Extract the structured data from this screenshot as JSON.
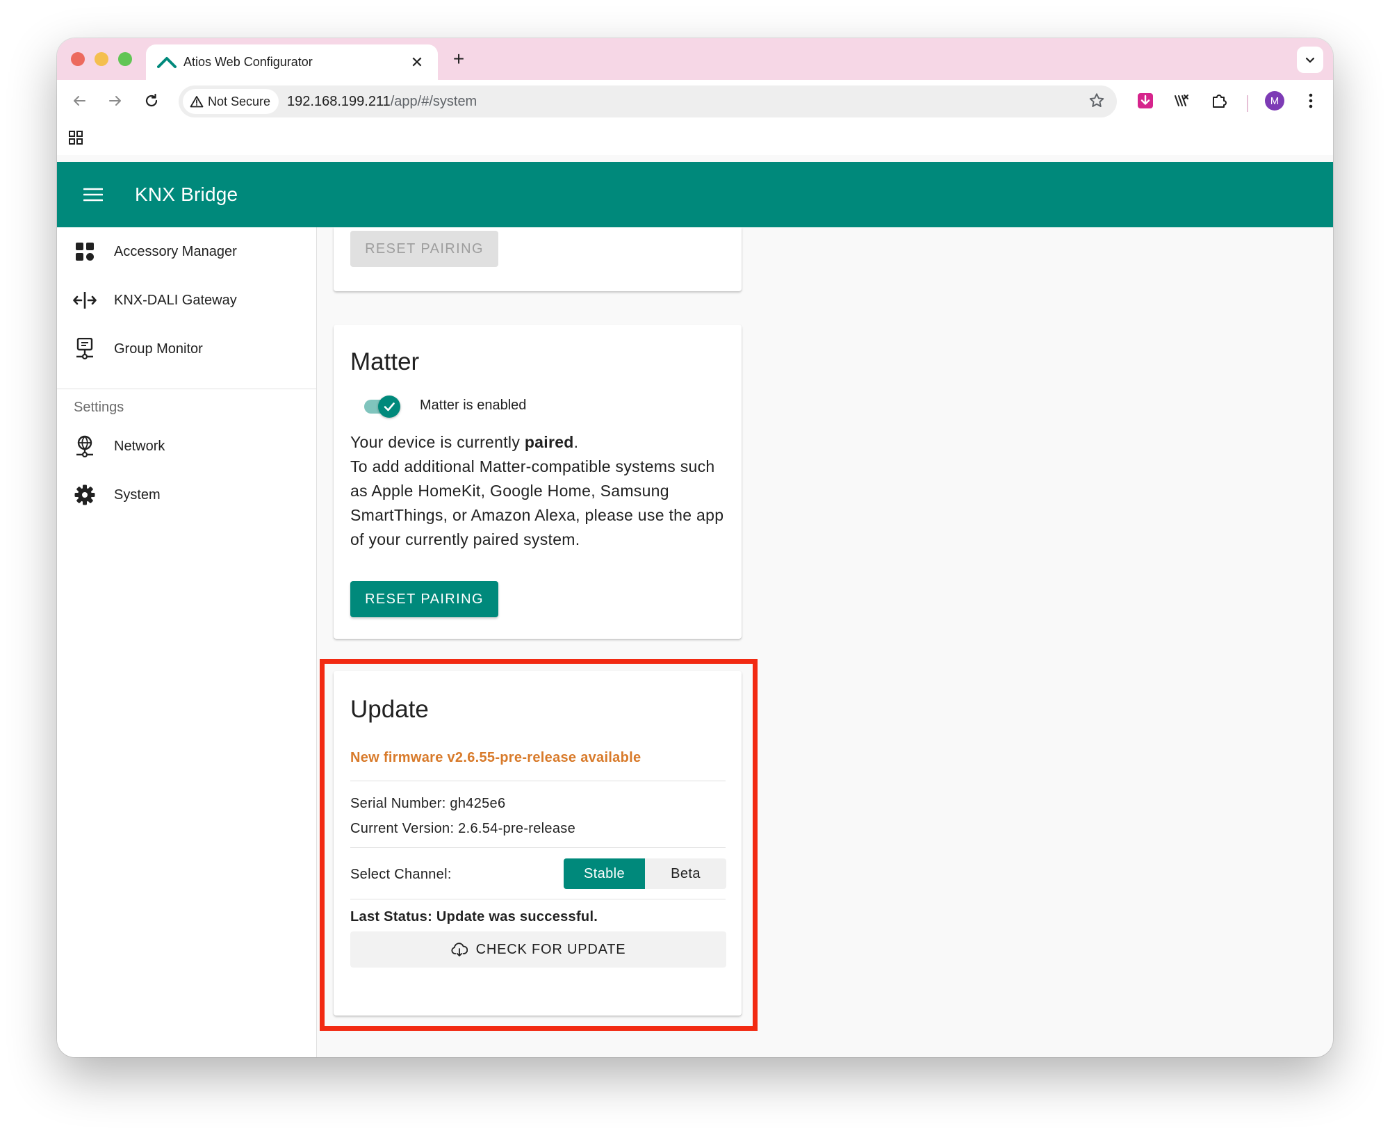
{
  "browser": {
    "tab_title": "Atios Web Configurator",
    "security_label": "Not Secure",
    "url_host": "192.168.199.211",
    "url_path": "/app/#/system",
    "profile_initial": "M"
  },
  "app": {
    "title": "KNX Bridge"
  },
  "sidebar": {
    "items": [
      {
        "label": "Accessory Manager",
        "icon": "dashboard-icon"
      },
      {
        "label": "KNX-DALI Gateway",
        "icon": "gateway-arrows-icon"
      },
      {
        "label": "Group Monitor",
        "icon": "monitor-icon"
      }
    ],
    "settings_header": "Settings",
    "settings_items": [
      {
        "label": "Network",
        "icon": "network-globe-icon"
      },
      {
        "label": "System",
        "icon": "gear-icon"
      }
    ]
  },
  "cards": {
    "top_card": {
      "button_label": "RESET PAIRING",
      "button_state": "disabled"
    },
    "matter": {
      "title": "Matter",
      "toggle_label": "Matter is enabled",
      "toggle_on": true,
      "status_prefix": "Your device is currently ",
      "status_value": "paired",
      "status_suffix": ".",
      "description": "To add additional Matter-compatible systems such as Apple HomeKit, Google Home, Samsung SmartThings, or Amazon Alexa, please use the app of your currently paired system.",
      "button_label": "RESET PAIRING"
    },
    "update": {
      "title": "Update",
      "firmware_notice": "New firmware v2.6.55-pre-release available",
      "serial_number": "Serial Number: gh425e6",
      "current_version": "Current Version: 2.6.54-pre-release",
      "select_channel_label": "Select Channel:",
      "channels": [
        "Stable",
        "Beta"
      ],
      "selected_channel": "Stable",
      "last_status": "Last Status: Update was successful.",
      "check_button_label": "CHECK FOR UPDATE"
    }
  },
  "colors": {
    "primary": "#00897b",
    "tabstrip": "#f6d7e6",
    "firmware_notice": "#d87a2a",
    "highlight": "#f22a12"
  }
}
